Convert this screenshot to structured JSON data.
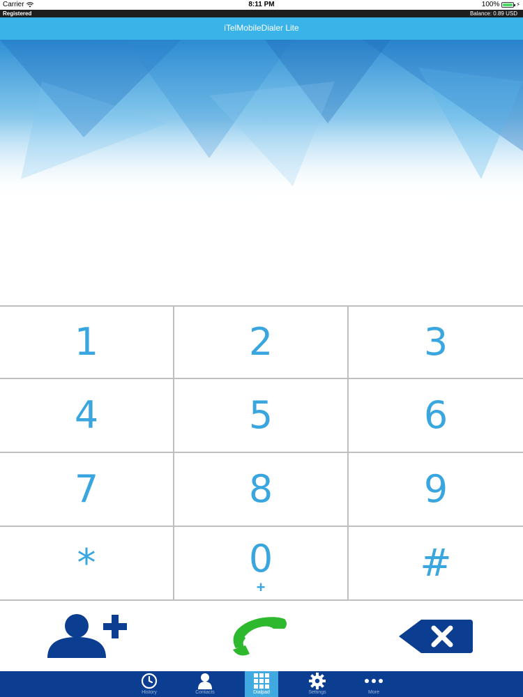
{
  "status_bar": {
    "carrier": "Carrier",
    "time": "8:11 PM",
    "battery": "100%"
  },
  "registration_bar": {
    "status": "Registered",
    "balance": "Balance: 0.89 USD"
  },
  "app": {
    "title": "iTelMobileDialer Lite"
  },
  "dialpad": {
    "keys": [
      {
        "digit": "1",
        "sub": ""
      },
      {
        "digit": "2",
        "sub": ""
      },
      {
        "digit": "3",
        "sub": ""
      },
      {
        "digit": "4",
        "sub": ""
      },
      {
        "digit": "5",
        "sub": ""
      },
      {
        "digit": "6",
        "sub": ""
      },
      {
        "digit": "7",
        "sub": ""
      },
      {
        "digit": "8",
        "sub": ""
      },
      {
        "digit": "9",
        "sub": ""
      },
      {
        "digit": "*",
        "sub": ""
      },
      {
        "digit": "0",
        "sub": "+"
      },
      {
        "digit": "#",
        "sub": ""
      }
    ]
  },
  "actions": {
    "add_contact_icon": "add-contact-icon",
    "call_icon": "phone-call-icon",
    "backspace_icon": "backspace-icon"
  },
  "tabs": [
    {
      "label": "History",
      "icon": "clock-icon",
      "active": false
    },
    {
      "label": "Contacts",
      "icon": "person-icon",
      "active": false
    },
    {
      "label": "Dialpad",
      "icon": "dialpad-grid-icon",
      "active": true
    },
    {
      "label": "Settings",
      "icon": "gear-icon",
      "active": false
    },
    {
      "label": "More",
      "icon": "more-dots-icon",
      "active": false
    }
  ],
  "colors": {
    "title_bar": "#39b3e8",
    "key_digit": "#3aa6e0",
    "contact_icon": "#0b3d91",
    "call_button": "#2db82d",
    "tab_bar": "#0b3d91",
    "tab_active": "#3fa9e0"
  }
}
